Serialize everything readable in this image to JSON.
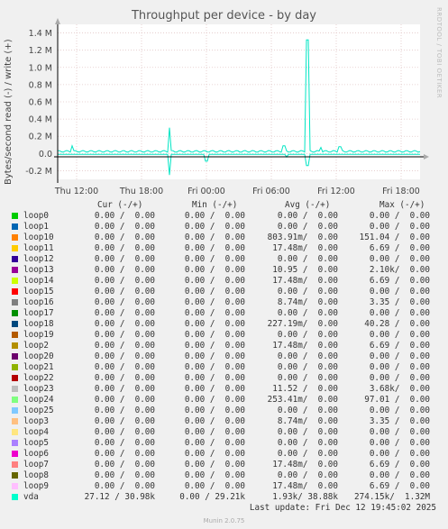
{
  "chart_data": {
    "type": "line",
    "title": "Throughput per device - by day",
    "ylabel": "Bytes/second read (-) / write (+)",
    "ylim": [
      -0.3,
      1.5
    ],
    "yticks": [
      "1.4 M",
      "1.2 M",
      "1.0 M",
      "0.8 M",
      "0.6 M",
      "0.4 M",
      "0.2 M",
      "0.0",
      "-0.2 M"
    ],
    "xticks": [
      "Thu 12:00",
      "Thu 18:00",
      "Fri 00:00",
      "Fri 06:00",
      "Fri 12:00",
      "Fri 18:00"
    ],
    "grid": true,
    "series": [
      {
        "name": "vda",
        "color": "#00e5c4",
        "description": "write spikes: ~0.3M at Thu 22:30, ~1.32M at Fri 09:00; baseline ~0.03M; read dips to ~-0.2M"
      }
    ]
  },
  "side_label": "RRDTOOL / TOBI OETIKER",
  "legend_headers": {
    "cur": "Cur (-/+)",
    "min": "Min (-/+)",
    "avg": "Avg (-/+)",
    "max": "Max (-/+)"
  },
  "legend": [
    {
      "name": "loop0",
      "color": "#00cc00",
      "cur": "0.00 /  0.00",
      "min": "0.00 /  0.00",
      "avg": "0.00 /  0.00",
      "max": "0.00 /  0.00"
    },
    {
      "name": "loop1",
      "color": "#0066b3",
      "cur": "0.00 /  0.00",
      "min": "0.00 /  0.00",
      "avg": "0.00 /  0.00",
      "max": "0.00 /  0.00"
    },
    {
      "name": "loop10",
      "color": "#ff8000",
      "cur": "0.00 /  0.00",
      "min": "0.00 /  0.00",
      "avg": "803.91m/  0.00",
      "max": "151.04 /  0.00"
    },
    {
      "name": "loop11",
      "color": "#ffcc00",
      "cur": "0.00 /  0.00",
      "min": "0.00 /  0.00",
      "avg": "17.48m/  0.00",
      "max": "6.69 /  0.00"
    },
    {
      "name": "loop12",
      "color": "#330099",
      "cur": "0.00 /  0.00",
      "min": "0.00 /  0.00",
      "avg": "0.00 /  0.00",
      "max": "0.00 /  0.00"
    },
    {
      "name": "loop13",
      "color": "#990099",
      "cur": "0.00 /  0.00",
      "min": "0.00 /  0.00",
      "avg": "10.95 /  0.00",
      "max": "2.10k/  0.00"
    },
    {
      "name": "loop14",
      "color": "#ccff00",
      "cur": "0.00 /  0.00",
      "min": "0.00 /  0.00",
      "avg": "17.48m/  0.00",
      "max": "6.69 /  0.00"
    },
    {
      "name": "loop15",
      "color": "#ff0000",
      "cur": "0.00 /  0.00",
      "min": "0.00 /  0.00",
      "avg": "0.00 /  0.00",
      "max": "0.00 /  0.00"
    },
    {
      "name": "loop16",
      "color": "#808080",
      "cur": "0.00 /  0.00",
      "min": "0.00 /  0.00",
      "avg": "8.74m/  0.00",
      "max": "3.35 /  0.00"
    },
    {
      "name": "loop17",
      "color": "#008f00",
      "cur": "0.00 /  0.00",
      "min": "0.00 /  0.00",
      "avg": "0.00 /  0.00",
      "max": "0.00 /  0.00"
    },
    {
      "name": "loop18",
      "color": "#00487d",
      "cur": "0.00 /  0.00",
      "min": "0.00 /  0.00",
      "avg": "227.19m/  0.00",
      "max": "40.28 /  0.00"
    },
    {
      "name": "loop19",
      "color": "#b35a00",
      "cur": "0.00 /  0.00",
      "min": "0.00 /  0.00",
      "avg": "0.00 /  0.00",
      "max": "0.00 /  0.00"
    },
    {
      "name": "loop2",
      "color": "#b38f00",
      "cur": "0.00 /  0.00",
      "min": "0.00 /  0.00",
      "avg": "17.48m/  0.00",
      "max": "6.69 /  0.00"
    },
    {
      "name": "loop20",
      "color": "#6b006b",
      "cur": "0.00 /  0.00",
      "min": "0.00 /  0.00",
      "avg": "0.00 /  0.00",
      "max": "0.00 /  0.00"
    },
    {
      "name": "loop21",
      "color": "#8fb300",
      "cur": "0.00 /  0.00",
      "min": "0.00 /  0.00",
      "avg": "0.00 /  0.00",
      "max": "0.00 /  0.00"
    },
    {
      "name": "loop22",
      "color": "#b30000",
      "cur": "0.00 /  0.00",
      "min": "0.00 /  0.00",
      "avg": "0.00 /  0.00",
      "max": "0.00 /  0.00"
    },
    {
      "name": "loop23",
      "color": "#bebebe",
      "cur": "0.00 /  0.00",
      "min": "0.00 /  0.00",
      "avg": "11.52 /  0.00",
      "max": "3.68k/  0.00"
    },
    {
      "name": "loop24",
      "color": "#80ff80",
      "cur": "0.00 /  0.00",
      "min": "0.00 /  0.00",
      "avg": "253.41m/  0.00",
      "max": "97.01 /  0.00"
    },
    {
      "name": "loop25",
      "color": "#80c9ff",
      "cur": "0.00 /  0.00",
      "min": "0.00 /  0.00",
      "avg": "0.00 /  0.00",
      "max": "0.00 /  0.00"
    },
    {
      "name": "loop3",
      "color": "#ffc080",
      "cur": "0.00 /  0.00",
      "min": "0.00 /  0.00",
      "avg": "8.74m/  0.00",
      "max": "3.35 /  0.00"
    },
    {
      "name": "loop4",
      "color": "#ffe680",
      "cur": "0.00 /  0.00",
      "min": "0.00 /  0.00",
      "avg": "0.00 /  0.00",
      "max": "0.00 /  0.00"
    },
    {
      "name": "loop5",
      "color": "#aa80ff",
      "cur": "0.00 /  0.00",
      "min": "0.00 /  0.00",
      "avg": "0.00 /  0.00",
      "max": "0.00 /  0.00"
    },
    {
      "name": "loop6",
      "color": "#ee00cc",
      "cur": "0.00 /  0.00",
      "min": "0.00 /  0.00",
      "avg": "0.00 /  0.00",
      "max": "0.00 /  0.00"
    },
    {
      "name": "loop7",
      "color": "#ff8080",
      "cur": "0.00 /  0.00",
      "min": "0.00 /  0.00",
      "avg": "17.48m/  0.00",
      "max": "6.69 /  0.00"
    },
    {
      "name": "loop8",
      "color": "#666600",
      "cur": "0.00 /  0.00",
      "min": "0.00 /  0.00",
      "avg": "0.00 /  0.00",
      "max": "0.00 /  0.00"
    },
    {
      "name": "loop9",
      "color": "#ffbfff",
      "cur": "0.00 /  0.00",
      "min": "0.00 /  0.00",
      "avg": "17.48m/  0.00",
      "max": "6.69 /  0.00"
    },
    {
      "name": "vda",
      "color": "#00ffcc",
      "cur": "27.12 / 30.98k",
      "min": "0.00 / 29.21k",
      "avg": "1.93k/ 38.88k",
      "max": "274.15k/  1.32M"
    }
  ],
  "last_update": "Last update: Fri Dec 12 19:45:02 2025",
  "footer": "Munin 2.0.75"
}
